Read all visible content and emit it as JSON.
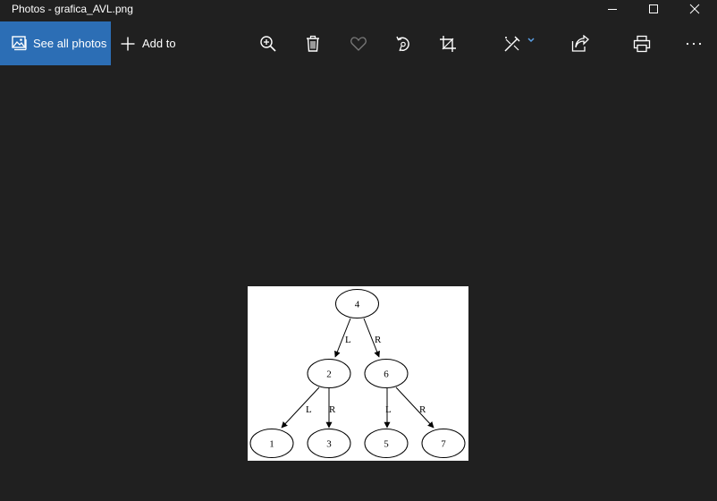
{
  "window": {
    "title": "Photos - grafica_AVL.png"
  },
  "toolbar": {
    "see_all_photos_label": "See all photos",
    "add_to_label": "Add to",
    "icons": [
      "zoom-in-icon",
      "delete-icon",
      "favorite-heart-icon",
      "rotate-icon",
      "crop-icon",
      "edit-create-icon",
      "share-icon",
      "print-icon",
      "more-icon"
    ]
  },
  "graph": {
    "nodes": {
      "n4": "4",
      "n2": "2",
      "n6": "6",
      "n1": "1",
      "n3": "3",
      "n5": "5",
      "n7": "7"
    },
    "edge_labels": {
      "e4_2": "L",
      "e4_6": "R",
      "e2_1": "L",
      "e2_3": "R",
      "e6_5": "L",
      "e6_7": "R"
    }
  },
  "colors": {
    "background": "#202020",
    "accent": "#2c6eb5",
    "chevron": "#5aa0e6"
  }
}
